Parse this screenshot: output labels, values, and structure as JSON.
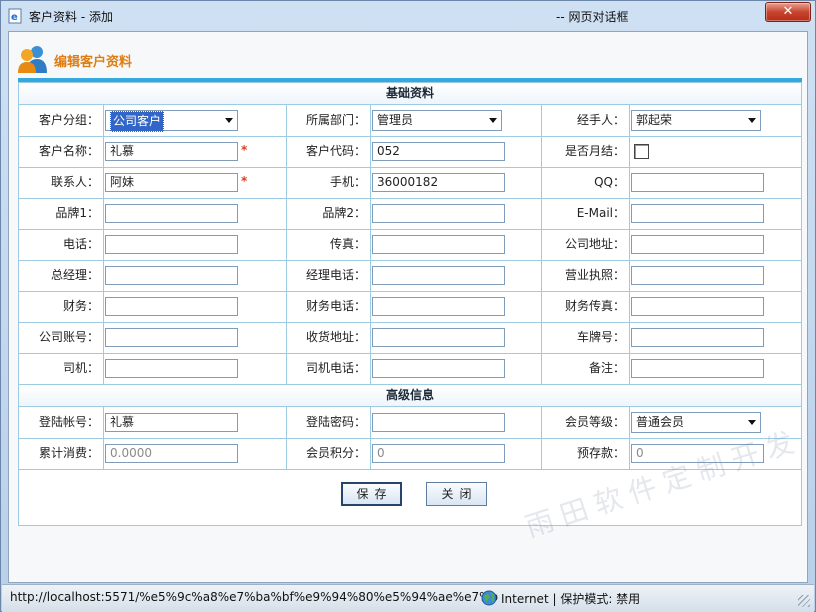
{
  "window": {
    "title": "客户资料 - 添加",
    "subtitle": "-- 网页对话框",
    "close_glyph": "✕"
  },
  "header": {
    "title": "编辑客户资料",
    "icon": "users-icon"
  },
  "sections": {
    "basic": "基础资料",
    "advanced": "高级信息"
  },
  "fields": {
    "group": {
      "label": "客户分组：",
      "value": "公司客户"
    },
    "department": {
      "label": "所属部门：",
      "value": "管理员"
    },
    "handler": {
      "label": "经手人：",
      "value": "郭起荣"
    },
    "name": {
      "label": "客户名称：",
      "value": "礼慕",
      "required": "*"
    },
    "code": {
      "label": "客户代码：",
      "value": "052"
    },
    "monthly": {
      "label": "是否月结：",
      "checked": false
    },
    "contact": {
      "label": "联系人：",
      "value": "阿妹",
      "required": "*"
    },
    "mobile": {
      "label": "手机：",
      "value": "36000182"
    },
    "qq": {
      "label": "QQ：",
      "value": ""
    },
    "brand1": {
      "label": "品牌1：",
      "value": ""
    },
    "brand2": {
      "label": "品牌2：",
      "value": ""
    },
    "email": {
      "label": "E-Mail：",
      "value": ""
    },
    "phone": {
      "label": "电话：",
      "value": ""
    },
    "fax": {
      "label": "传真：",
      "value": ""
    },
    "company_addr": {
      "label": "公司地址：",
      "value": ""
    },
    "manager": {
      "label": "总经理：",
      "value": ""
    },
    "manager_tel": {
      "label": "经理电话：",
      "value": ""
    },
    "license": {
      "label": "营业执照：",
      "value": ""
    },
    "finance": {
      "label": "财务：",
      "value": ""
    },
    "finance_tel": {
      "label": "财务电话：",
      "value": ""
    },
    "finance_fax": {
      "label": "财务传真：",
      "value": ""
    },
    "account": {
      "label": "公司账号：",
      "value": ""
    },
    "delivery": {
      "label": "收货地址：",
      "value": ""
    },
    "plate": {
      "label": "车牌号：",
      "value": ""
    },
    "driver": {
      "label": "司机：",
      "value": ""
    },
    "driver_tel": {
      "label": "司机电话：",
      "value": ""
    },
    "remark": {
      "label": "备注：",
      "value": ""
    },
    "login": {
      "label": "登陆帐号：",
      "value": "礼慕"
    },
    "password": {
      "label": "登陆密码：",
      "value": ""
    },
    "level": {
      "label": "会员等级：",
      "value": "普通会员"
    },
    "total_spend": {
      "label": "累计消费：",
      "value": "0.0000"
    },
    "points": {
      "label": "会员积分：",
      "value": "0"
    },
    "deposit": {
      "label": "预存款：",
      "value": "0"
    }
  },
  "buttons": {
    "save": "保存",
    "close": "关闭"
  },
  "watermark": "雨田软件定制开发",
  "statusbar": {
    "url": "http://localhost:5571/%e5%9c%a8%e7%ba%bf%e9%94%80%e5%94%ae%e7%b",
    "zone": "Internet | 保护模式: 禁用"
  },
  "colors": {
    "accent_orange": "#e07d12",
    "section_bar_blue": "#35a8de",
    "required_red": "#e23a1c"
  }
}
